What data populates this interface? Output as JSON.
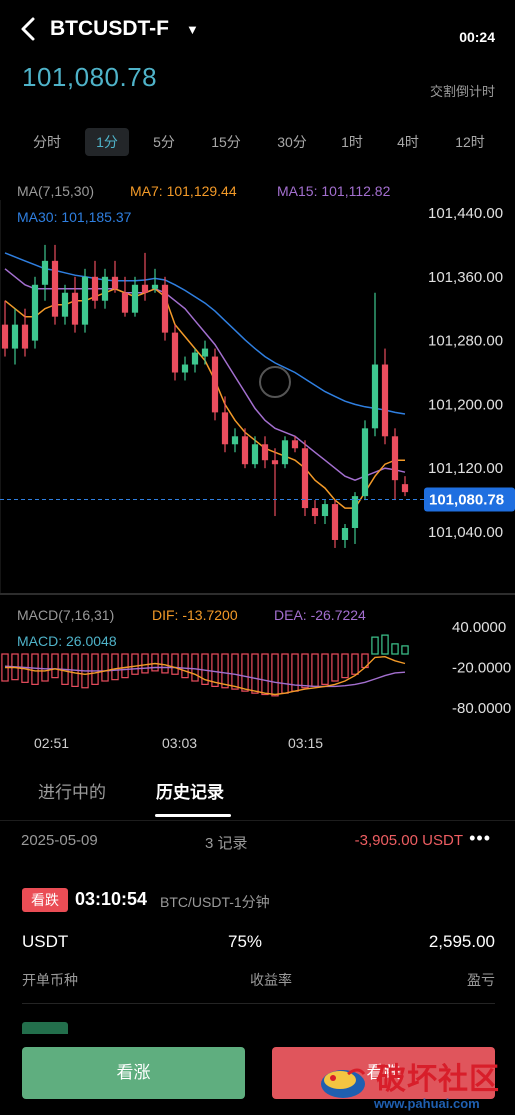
{
  "header": {
    "back_icon": "chevron-left-icon",
    "symbol": "BTCUSDT-F",
    "dropdown_icon": "caret-down-icon",
    "last_price": "101,080.78",
    "countdown": "00:24",
    "countdown_label": "交割倒计时"
  },
  "timeframes": {
    "items": [
      "分时",
      "1分",
      "5分",
      "15分",
      "30分",
      "1时",
      "4时",
      "12时"
    ],
    "active": "1分"
  },
  "ma_legend": {
    "label": "MA(7,15,30)",
    "ma7": "MA7: 101,129.44",
    "ma15": "MA15: 101,112.82",
    "ma30": "MA30: 101,185.37",
    "colors": {
      "ma7": "#f39a28",
      "ma15": "#a36fcf",
      "ma30": "#2f7fe0"
    }
  },
  "price_axis": {
    "ticks": [
      "101,440.00",
      "101,360.00",
      "101,280.00",
      "101,200.00",
      "101,120.00",
      "101,040.00"
    ],
    "current_tag": "101,080.78"
  },
  "macd_legend": {
    "label": "MACD(7,16,31)",
    "dif": "DIF: -13.7200",
    "dea": "DEA: -26.7224",
    "macd": "MACD: 26.0048",
    "ticks": [
      "40.0000",
      "-20.0000",
      "-80.0000"
    ],
    "colors": {
      "dif": "#f39a28",
      "dea": "#a36fcf",
      "macd": "#4fb3c9"
    }
  },
  "time_axis": [
    "02:51",
    "03:03",
    "03:15"
  ],
  "colors": {
    "up": "#3ec78f",
    "down": "#ea4d5e",
    "accent": "#4fb3c9"
  },
  "chart_data": {
    "type": "candlestick",
    "y_range": [
      101000,
      101460
    ],
    "candles": [
      {
        "o": 101300,
        "h": 101330,
        "l": 101260,
        "c": 101270
      },
      {
        "o": 101270,
        "h": 101320,
        "l": 101250,
        "c": 101300
      },
      {
        "o": 101300,
        "h": 101320,
        "l": 101260,
        "c": 101270
      },
      {
        "o": 101280,
        "h": 101360,
        "l": 101270,
        "c": 101350
      },
      {
        "o": 101350,
        "h": 101400,
        "l": 101330,
        "c": 101380
      },
      {
        "o": 101380,
        "h": 101400,
        "l": 101300,
        "c": 101310
      },
      {
        "o": 101310,
        "h": 101350,
        "l": 101300,
        "c": 101340
      },
      {
        "o": 101340,
        "h": 101360,
        "l": 101290,
        "c": 101300
      },
      {
        "o": 101300,
        "h": 101370,
        "l": 101290,
        "c": 101360
      },
      {
        "o": 101360,
        "h": 101380,
        "l": 101320,
        "c": 101330
      },
      {
        "o": 101330,
        "h": 101370,
        "l": 101320,
        "c": 101360
      },
      {
        "o": 101360,
        "h": 101380,
        "l": 101340,
        "c": 101345
      },
      {
        "o": 101340,
        "h": 101360,
        "l": 101310,
        "c": 101315
      },
      {
        "o": 101315,
        "h": 101360,
        "l": 101310,
        "c": 101350
      },
      {
        "o": 101350,
        "h": 101390,
        "l": 101330,
        "c": 101340
      },
      {
        "o": 101345,
        "h": 101370,
        "l": 101340,
        "c": 101350
      },
      {
        "o": 101350,
        "h": 101360,
        "l": 101280,
        "c": 101290
      },
      {
        "o": 101290,
        "h": 101300,
        "l": 101230,
        "c": 101240
      },
      {
        "o": 101240,
        "h": 101260,
        "l": 101230,
        "c": 101250
      },
      {
        "o": 101250,
        "h": 101270,
        "l": 101240,
        "c": 101265
      },
      {
        "o": 101260,
        "h": 101280,
        "l": 101250,
        "c": 101270
      },
      {
        "o": 101260,
        "h": 101270,
        "l": 101180,
        "c": 101190
      },
      {
        "o": 101190,
        "h": 101210,
        "l": 101140,
        "c": 101150
      },
      {
        "o": 101150,
        "h": 101170,
        "l": 101140,
        "c": 101160
      },
      {
        "o": 101160,
        "h": 101170,
        "l": 101120,
        "c": 101125
      },
      {
        "o": 101125,
        "h": 101160,
        "l": 101120,
        "c": 101150
      },
      {
        "o": 101150,
        "h": 101160,
        "l": 101120,
        "c": 101130
      },
      {
        "o": 101130,
        "h": 101145,
        "l": 101060,
        "c": 101125
      },
      {
        "o": 101125,
        "h": 101160,
        "l": 101120,
        "c": 101155
      },
      {
        "o": 101155,
        "h": 101160,
        "l": 101140,
        "c": 101145
      },
      {
        "o": 101145,
        "h": 101155,
        "l": 101060,
        "c": 101070
      },
      {
        "o": 101070,
        "h": 101080,
        "l": 101050,
        "c": 101060
      },
      {
        "o": 101060,
        "h": 101080,
        "l": 101050,
        "c": 101075
      },
      {
        "o": 101075,
        "h": 101080,
        "l": 101020,
        "c": 101030
      },
      {
        "o": 101030,
        "h": 101050,
        "l": 101020,
        "c": 101045
      },
      {
        "o": 101045,
        "h": 101090,
        "l": 101025,
        "c": 101085
      },
      {
        "o": 101085,
        "h": 101180,
        "l": 101080,
        "c": 101170
      },
      {
        "o": 101170,
        "h": 101340,
        "l": 101160,
        "c": 101250
      },
      {
        "o": 101250,
        "h": 101270,
        "l": 101150,
        "c": 101160
      },
      {
        "o": 101160,
        "h": 101170,
        "l": 101080,
        "c": 101105
      },
      {
        "o": 101100,
        "h": 101110,
        "l": 101085,
        "c": 101090
      }
    ],
    "ma7": [
      101330,
      101320,
      101310,
      101310,
      101320,
      101325,
      101325,
      101330,
      101330,
      101335,
      101340,
      101345,
      101340,
      101335,
      101340,
      101345,
      101335,
      101300,
      101285,
      101270,
      101255,
      101230,
      101200,
      101180,
      101165,
      101155,
      101145,
      101140,
      101135,
      101130,
      101120,
      101105,
      101095,
      101080,
      101070,
      101070,
      101090,
      101110,
      101125,
      101130,
      101130
    ],
    "ma15": [
      101370,
      101360,
      101350,
      101345,
      101345,
      101345,
      101345,
      101345,
      101345,
      101345,
      101345,
      101345,
      101340,
      101340,
      101340,
      101345,
      101340,
      101330,
      101320,
      101305,
      101290,
      101275,
      101255,
      101235,
      101215,
      101195,
      101180,
      101170,
      101165,
      101160,
      101150,
      101140,
      101130,
      101120,
      101110,
      101105,
      101110,
      101115,
      101120,
      101118,
      101115
    ],
    "ma30": [
      101390,
      101385,
      101380,
      101375,
      101370,
      101368,
      101365,
      101362,
      101360,
      101358,
      101356,
      101355,
      101355,
      101355,
      101356,
      101358,
      101356,
      101350,
      101343,
      101335,
      101327,
      101317,
      101305,
      101293,
      101281,
      101270,
      101260,
      101252,
      101246,
      101240,
      101232,
      101224,
      101216,
      101210,
      101204,
      101200,
      101197,
      101195,
      101193,
      101190,
      101188
    ],
    "macd": {
      "y_range": [
        -100,
        60
      ],
      "hist": [
        -40,
        -38,
        -42,
        -45,
        -40,
        -35,
        -45,
        -48,
        -50,
        -45,
        -40,
        -38,
        -35,
        -30,
        -28,
        -25,
        -28,
        -30,
        -35,
        -40,
        -45,
        -48,
        -50,
        -52,
        -55,
        -58,
        -60,
        -62,
        -58,
        -55,
        -50,
        -48,
        -45,
        -40,
        -35,
        -30,
        -20,
        25,
        28,
        15,
        12
      ],
      "dif": [
        -20,
        -20,
        -22,
        -25,
        -25,
        -22,
        -25,
        -28,
        -30,
        -28,
        -25,
        -22,
        -20,
        -18,
        -16,
        -14,
        -16,
        -20,
        -25,
        -30,
        -38,
        -42,
        -45,
        -48,
        -52,
        -55,
        -58,
        -60,
        -58,
        -55,
        -52,
        -50,
        -48,
        -45,
        -40,
        -32,
        -20,
        -5,
        -4,
        -10,
        -14
      ],
      "dea": [
        -18,
        -19,
        -20,
        -21,
        -22,
        -22,
        -23,
        -24,
        -25,
        -25,
        -25,
        -24,
        -23,
        -22,
        -21,
        -20,
        -20,
        -20,
        -21,
        -22,
        -24,
        -26,
        -28,
        -30,
        -33,
        -36,
        -39,
        -42,
        -44,
        -46,
        -47,
        -48,
        -48,
        -48,
        -47,
        -45,
        -42,
        -37,
        -32,
        -28,
        -27
      ]
    }
  },
  "history": {
    "tabs": [
      "进行中的",
      "历史记录"
    ],
    "summary": {
      "date": "2025-05-09",
      "count": "3 记录",
      "pnl": "-3,905.00 USDT",
      "more_icon": "more-dots-icon"
    },
    "order": {
      "direction": "看跌",
      "time": "03:10:54",
      "pair": "BTC/USDT-1分钟",
      "currency": "USDT",
      "rate": "75%",
      "pnl": "2,595.00",
      "labels": [
        "开单币种",
        "收益率",
        "盈亏"
      ]
    }
  },
  "actions": {
    "buy_up": "看涨",
    "buy_down": "看跌"
  },
  "watermark": {
    "text": "破坏社区",
    "url": "www.pahuai.com"
  }
}
